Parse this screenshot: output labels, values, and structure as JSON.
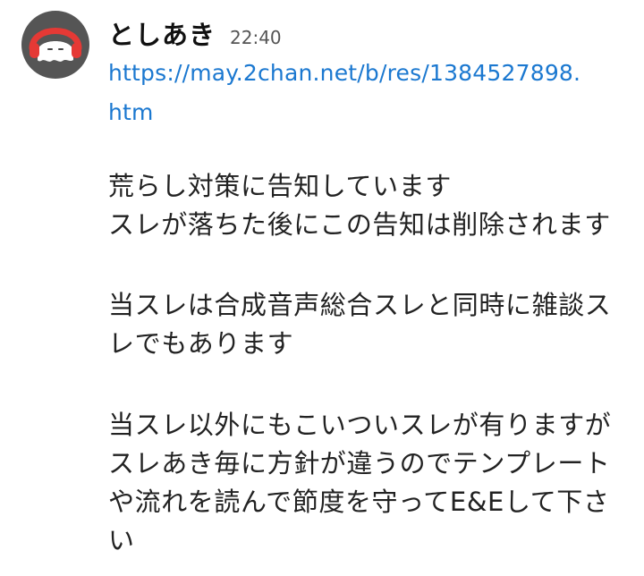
{
  "message": {
    "author": "としあき",
    "timestamp": "22:40",
    "link": {
      "text": "https://may.2chan.net/b/res/1384527898.htm"
    },
    "paragraphs": [
      {
        "lines": [
          "荒らし対策に告知しています",
          "スレが落ちた後にこの告知は削除されます"
        ]
      },
      {
        "lines": [
          "当スレは合成音声総合スレと同時に雑談ス",
          "レでもあります"
        ]
      },
      {
        "lines": [
          "当スレ以外にもこいついスレが有りますが",
          "スレあき毎に方針が違うのでテンプレート",
          "や流れを読んで節度を守ってE&Eして下さ",
          "い"
        ]
      }
    ]
  },
  "colors": {
    "link": "#1b78d0",
    "avatar_bg": "#555555",
    "avatar_accent": "#e53935"
  },
  "icons": {
    "avatar": "ghost-with-headphones-icon"
  }
}
